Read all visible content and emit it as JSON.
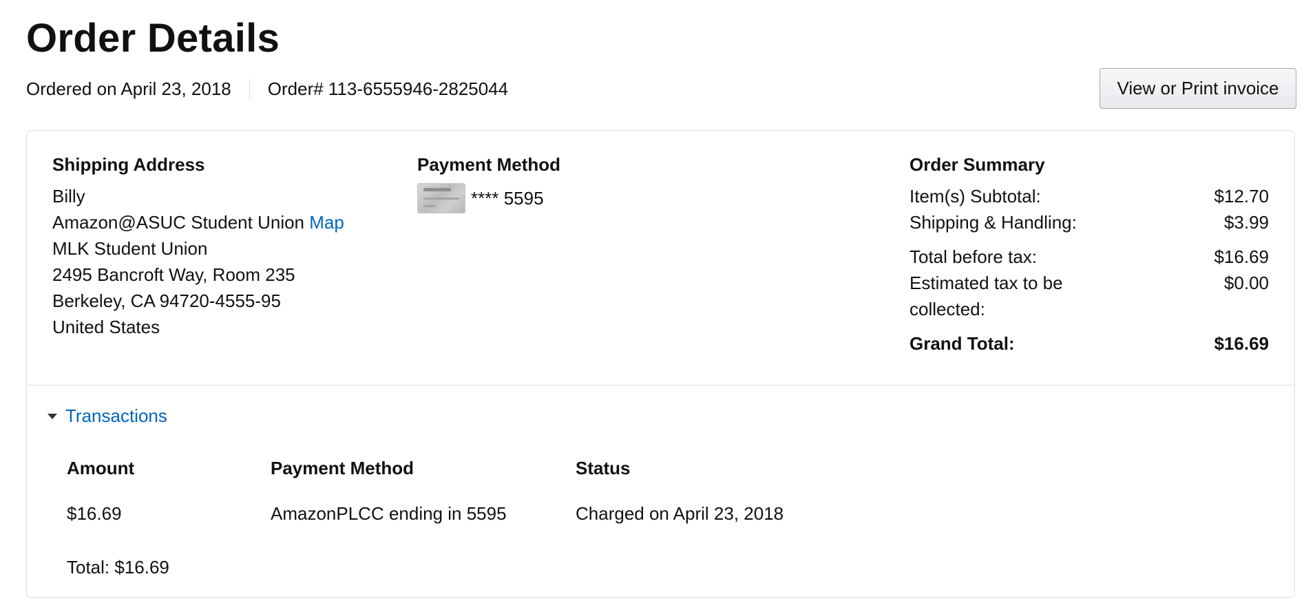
{
  "page": {
    "title": "Order Details",
    "ordered_on": "Ordered on April 23, 2018",
    "order_number": "Order# 113-6555946-2825044",
    "invoice_button": "View or Print invoice"
  },
  "shipping": {
    "heading": "Shipping Address",
    "name": "Billy",
    "line1": "Amazon@ASUC Student Union",
    "map_link": "Map",
    "line2": "MLK Student Union",
    "line3": "2495 Bancroft Way, Room 235",
    "line4": "Berkeley, CA 94720-4555-95",
    "country": "United States"
  },
  "payment": {
    "heading": "Payment Method",
    "card_icon": "amazon-card-icon",
    "card_mask": "**** 5595"
  },
  "summary": {
    "heading": "Order Summary",
    "rows": [
      {
        "label": "Item(s) Subtotal:",
        "value": "$12.70"
      },
      {
        "label": "Shipping & Handling:",
        "value": "$3.99"
      },
      {
        "label": "Total before tax:",
        "value": "$16.69"
      },
      {
        "label": "Estimated tax to be collected:",
        "value": "$0.00"
      }
    ],
    "grand_label": "Grand Total:",
    "grand_value": "$16.69"
  },
  "transactions": {
    "toggle_label": "Transactions",
    "caret_icon": "caret-down-icon",
    "columns": [
      "Amount",
      "Payment Method",
      "Status"
    ],
    "rows": [
      {
        "amount": "$16.69",
        "method": "AmazonPLCC ending in 5595",
        "status": "Charged on April 23, 2018"
      }
    ],
    "total": "Total: $16.69"
  },
  "colors": {
    "link": "#0066c0",
    "border": "#dddddd",
    "text": "#111111"
  }
}
